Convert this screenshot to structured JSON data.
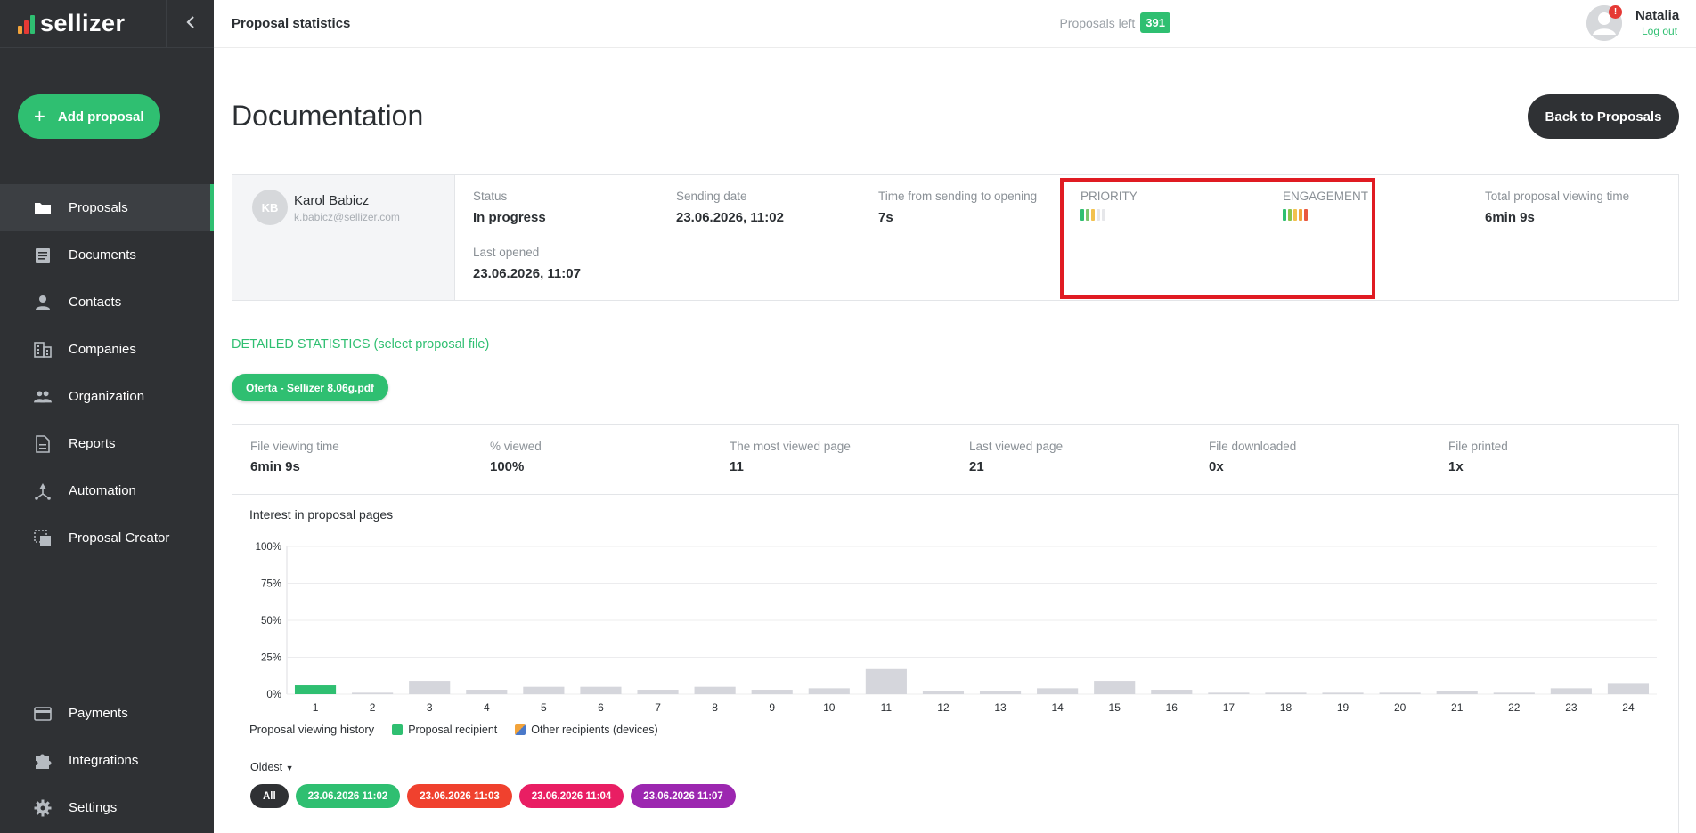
{
  "app": {
    "name": "sellizer"
  },
  "topbar": {
    "crumb": "Proposal statistics",
    "proposals_left_label": "Proposals left",
    "proposals_left_count": "391",
    "user_name": "Natalia",
    "logout": "Log out",
    "alert_badge": "!"
  },
  "sidebar": {
    "add_label": "Add proposal",
    "items": [
      {
        "label": "Proposals",
        "icon": "folder-icon"
      },
      {
        "label": "Documents",
        "icon": "document-icon"
      },
      {
        "label": "Contacts",
        "icon": "person-icon"
      },
      {
        "label": "Companies",
        "icon": "building-icon"
      },
      {
        "label": "Organization",
        "icon": "people-icon"
      },
      {
        "label": "Reports",
        "icon": "report-icon"
      },
      {
        "label": "Automation",
        "icon": "automation-icon"
      },
      {
        "label": "Proposal Creator",
        "icon": "creator-icon"
      }
    ],
    "bottom_items": [
      {
        "label": "Payments",
        "icon": "card-icon"
      },
      {
        "label": "Integrations",
        "icon": "puzzle-icon"
      },
      {
        "label": "Settings",
        "icon": "gear-icon"
      }
    ]
  },
  "page": {
    "title": "Documentation",
    "back_button": "Back to Proposals"
  },
  "summary": {
    "initials": "KB",
    "name": "Karol Babicz",
    "email": "k.babicz@sellizer.com",
    "status_label": "Status",
    "status_value": "In progress",
    "sending_label": "Sending date",
    "sending_value": "23.06.2026, 11:02",
    "time_label": "Time from sending to opening",
    "time_value": "7s",
    "last_opened_label": "Last opened",
    "last_opened_value": "23.06.2026, 11:07",
    "priority_label": "PRIORITY",
    "priority_level": 3,
    "priority_max": 5,
    "engagement_label": "ENGAGEMENT",
    "engagement_level": 5,
    "engagement_max": 5,
    "total_time_label": "Total proposal viewing time",
    "total_time_value": "6min 9s"
  },
  "details": {
    "title": "DETAILED STATISTICS (select proposal file)",
    "file_chip": "Oferta - Sellizer 8.06g.pdf",
    "stats": [
      {
        "label": "File viewing time",
        "value": "6min 9s"
      },
      {
        "label": "% viewed",
        "value": "100%"
      },
      {
        "label": "The most viewed page",
        "value": "11"
      },
      {
        "label": "Last viewed page",
        "value": "21"
      },
      {
        "label": "File downloaded",
        "value": "0x"
      },
      {
        "label": "File printed",
        "value": "1x"
      }
    ],
    "chart_title": "Interest in proposal pages",
    "history_label": "Proposal viewing history",
    "legend_recipient": "Proposal recipient",
    "legend_other": "Other recipients (devices)",
    "sort_label": "Oldest",
    "chips": [
      {
        "label": "All",
        "color": "#2f3134"
      },
      {
        "label": "23.06.2026 11:02",
        "color": "#2fbf71"
      },
      {
        "label": "23.06.2026 11:03",
        "color": "#f0412e"
      },
      {
        "label": "23.06.2026 11:04",
        "color": "#e91e63"
      },
      {
        "label": "23.06.2026 11:07",
        "color": "#9c27b0"
      }
    ]
  },
  "colors": {
    "accent": "#2fbf71",
    "bar_gray": "#d5d6dc",
    "highlight": "#e01b22"
  },
  "chart_data": {
    "type": "bar",
    "title": "Interest in proposal pages",
    "categories": [
      "1",
      "2",
      "3",
      "4",
      "5",
      "6",
      "7",
      "8",
      "9",
      "10",
      "11",
      "12",
      "13",
      "14",
      "15",
      "16",
      "17",
      "18",
      "19",
      "20",
      "21",
      "22",
      "23",
      "24"
    ],
    "series": [
      {
        "name": "Proposal recipient",
        "color": "#2fbf71",
        "values": [
          6,
          0,
          0,
          0,
          0,
          0,
          0,
          0,
          0,
          0,
          0,
          0,
          0,
          0,
          0,
          0,
          0,
          0,
          0,
          0,
          0,
          0,
          0,
          0
        ]
      },
      {
        "name": "Other recipients (devices)",
        "color": "#d5d6dc",
        "values": [
          0,
          1,
          9,
          3,
          5,
          5,
          3,
          5,
          3,
          4,
          17,
          2,
          2,
          4,
          9,
          3,
          1,
          1,
          1,
          1,
          2,
          1,
          4,
          7
        ]
      }
    ],
    "yticks": [
      "0%",
      "25%",
      "50%",
      "75%",
      "100%"
    ],
    "ylim": [
      0,
      100
    ],
    "grid": true
  }
}
